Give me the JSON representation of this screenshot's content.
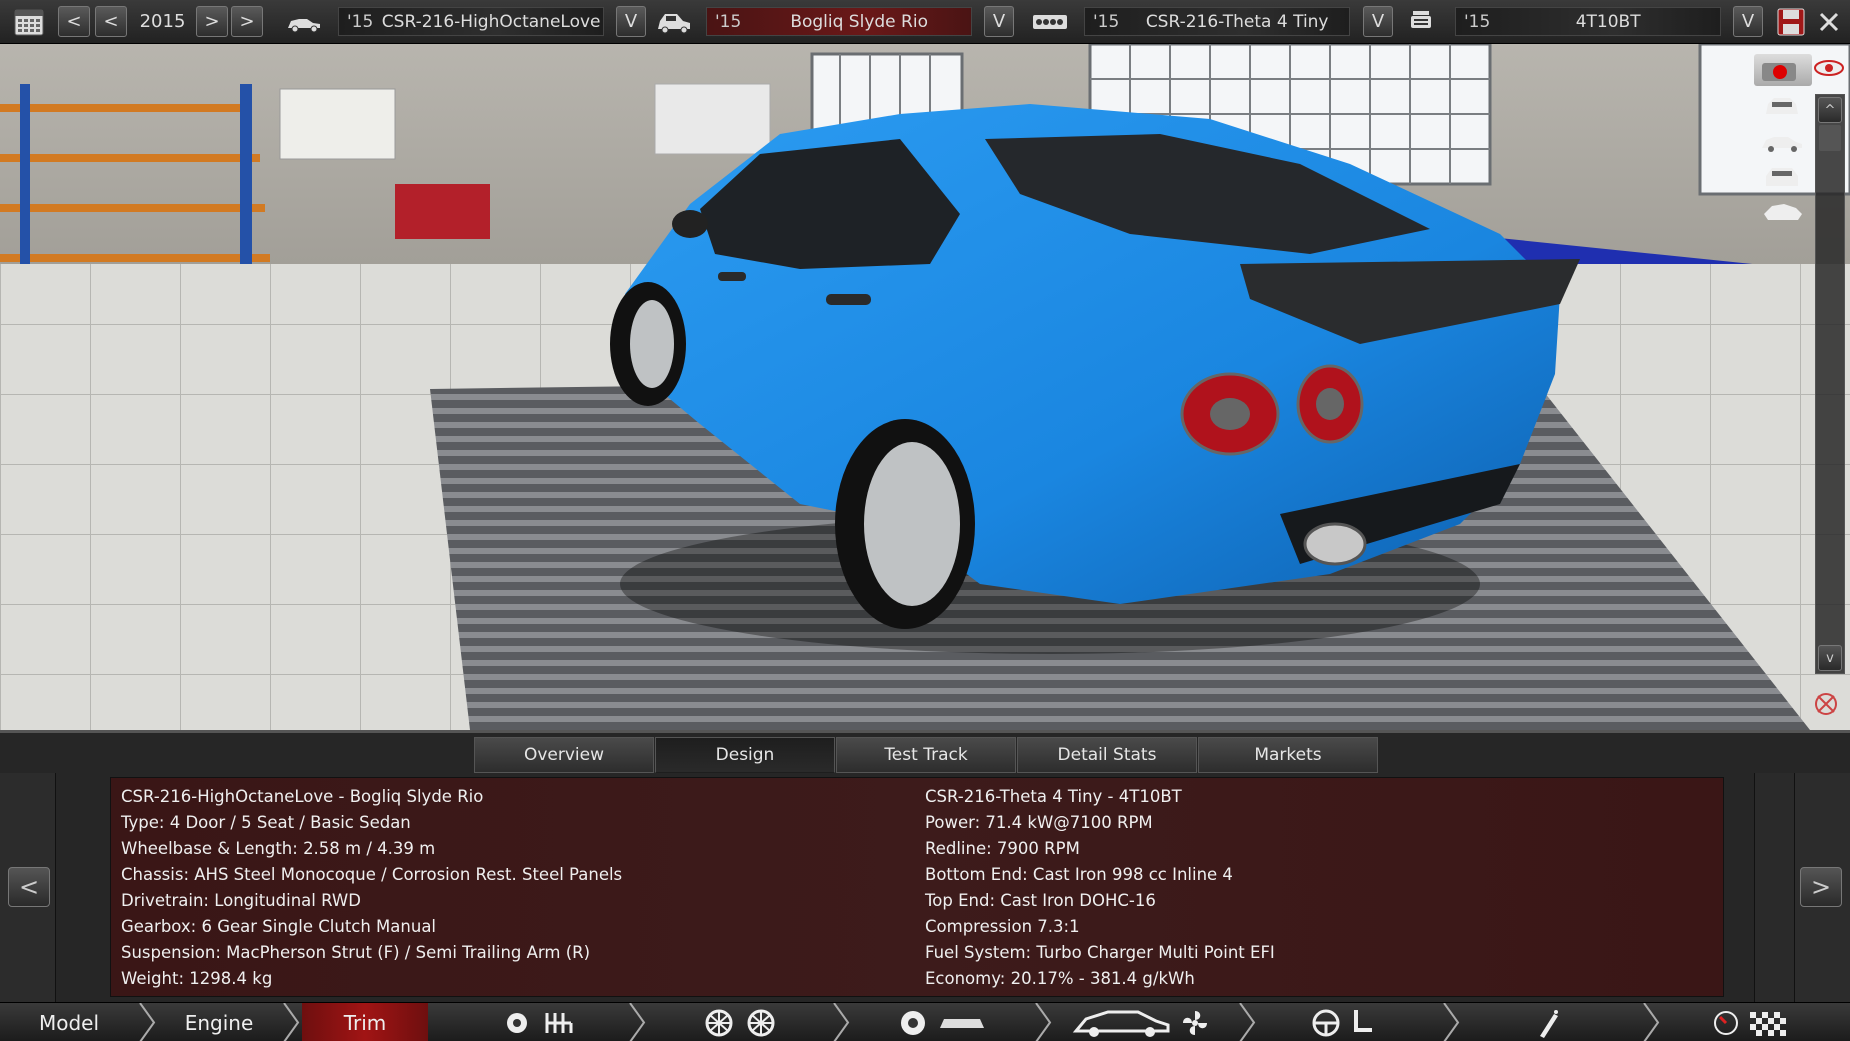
{
  "year": {
    "value": "2015"
  },
  "selectors": {
    "model": {
      "year": "'15",
      "name": "CSR-216-HighOctaneLove"
    },
    "trim": {
      "year": "'15",
      "name": "Bogliq Slyde Rio"
    },
    "engine_family": {
      "year": "'15",
      "name": "CSR-216-Theta 4 Tiny"
    },
    "engine_variant": {
      "year": "'15",
      "name": "4T10BT"
    }
  },
  "topbar_icons": {
    "calendar": "calendar-icon",
    "prev_fast": "<",
    "prev": "<",
    "next": ">",
    "next_fast": ">",
    "dropdown": "V"
  },
  "viewport_tools": {
    "scroll_up": "^",
    "scroll_down": "v"
  },
  "tabs": [
    {
      "label": "Overview",
      "active": false
    },
    {
      "label": "Design",
      "active": true
    },
    {
      "label": "Test Track",
      "active": false
    },
    {
      "label": "Detail Stats",
      "active": false
    },
    {
      "label": "Markets",
      "active": false
    }
  ],
  "info": {
    "left": [
      "CSR-216-HighOctaneLove - Bogliq Slyde Rio",
      "Type: 4 Door / 5 Seat / Basic Sedan",
      "Wheelbase & Length: 2.58 m / 4.39 m",
      "Chassis: AHS Steel Monocoque / Corrosion Rest. Steel Panels",
      "Drivetrain: Longitudinal RWD",
      "Gearbox: 6 Gear Single Clutch Manual",
      "Suspension: MacPherson Strut (F) / Semi Trailing Arm (R)",
      "Weight: 1298.4 kg"
    ],
    "right": [
      "CSR-216-Theta 4 Tiny - 4T10BT",
      "Power: 71.4 kW@7100 RPM",
      "Redline: 7900 RPM",
      "Bottom End: Cast Iron 998 cc Inline 4",
      "Top End: Cast Iron DOHC-16",
      "Compression 7.3:1",
      "Fuel System: Turbo Charger Multi Point EFI",
      "Economy: 20.17% - 381.4 g/kWh"
    ]
  },
  "panel_nav": {
    "prev": "<",
    "next": ">"
  },
  "bottom_nav": {
    "model": "Model",
    "engine": "Engine",
    "trim": "Trim"
  },
  "colors": {
    "accent_red": "#a11414",
    "car_body": "#1a86e0",
    "info_bg": "#3b1919"
  }
}
